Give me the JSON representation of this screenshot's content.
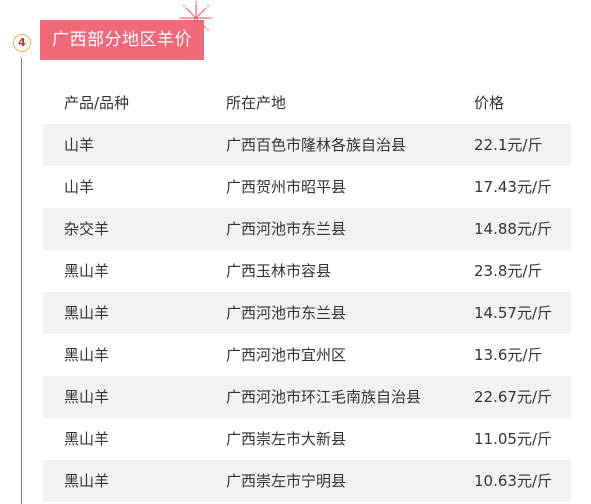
{
  "section": {
    "step_number": "4",
    "title": "广西部分地区羊价"
  },
  "table": {
    "columns": [
      "产品/品种",
      "所在产地",
      "价格"
    ],
    "rows": [
      [
        "山羊",
        "广西百色市隆林各族自治县",
        "22.1元/斤"
      ],
      [
        "山羊",
        "广西贺州市昭平县",
        "17.43元/斤"
      ],
      [
        "杂交羊",
        "广西河池市东兰县",
        "14.88元/斤"
      ],
      [
        "黑山羊",
        "广西玉林市容县",
        "23.8元/斤"
      ],
      [
        "黑山羊",
        "广西河池市东兰县",
        "14.57元/斤"
      ],
      [
        "黑山羊",
        "广西河池市宜州区",
        "13.6元/斤"
      ],
      [
        "黑山羊",
        "广西河池市环江毛南族自治县",
        "22.67元/斤"
      ],
      [
        "黑山羊",
        "广西崇左市大新县",
        "11.05元/斤"
      ],
      [
        "黑山羊",
        "广西崇左市宁明县",
        "10.63元/斤"
      ]
    ]
  },
  "colors": {
    "title_bg": "#f06a7a",
    "timeline": "#d9534f",
    "row_shade": "#f2f2f2"
  },
  "icons": {
    "decoration": "firework-icon"
  }
}
